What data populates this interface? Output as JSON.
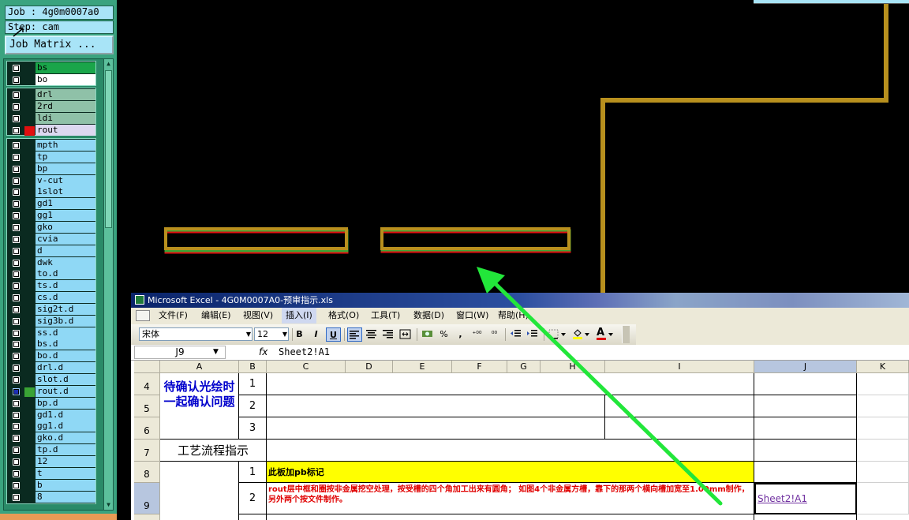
{
  "genesis": {
    "job_label": "Job : 4g0m0007a0",
    "step_label": "Step: cam",
    "job_matrix_button": "Job Matrix ...",
    "layers_group1": [
      {
        "name": "bs",
        "color": "#1aa54a",
        "checked": false,
        "swatch": ""
      },
      {
        "name": "bo",
        "color": "#ffffff",
        "checked": false,
        "swatch": ""
      }
    ],
    "layers_group2": [
      {
        "name": "drl",
        "color": "#8fc1a8",
        "checked": false,
        "swatch": ""
      },
      {
        "name": "2rd",
        "color": "#8fc1a8",
        "checked": false,
        "swatch": ""
      },
      {
        "name": "ldi",
        "color": "#8fc1a8",
        "checked": false,
        "swatch": ""
      },
      {
        "name": "rout",
        "color": "#dcd8f0",
        "checked": false,
        "swatch": "#e01010"
      }
    ],
    "layers_group3": [
      {
        "name": "mpth",
        "color": "#8fd8f5",
        "checked": false,
        "swatch": "",
        "mark": ""
      },
      {
        "name": "tp",
        "color": "#8fd8f5",
        "checked": false,
        "swatch": "",
        "mark": ""
      },
      {
        "name": "bp",
        "color": "#8fd8f5",
        "checked": false,
        "swatch": "",
        "mark": ""
      },
      {
        "name": "v-cut",
        "color": "#8fd8f5",
        "checked": false,
        "swatch": "",
        "mark": ""
      },
      {
        "name": "1slot",
        "color": "#8fd8f5",
        "checked": false,
        "swatch": "",
        "mark": ""
      },
      {
        "name": "gd1",
        "color": "#8fd8f5",
        "checked": false,
        "swatch": "",
        "mark": ""
      },
      {
        "name": "gg1",
        "color": "#8fd8f5",
        "checked": false,
        "swatch": "",
        "mark": ""
      },
      {
        "name": "gko",
        "color": "#8fd8f5",
        "checked": false,
        "swatch": "",
        "mark": ""
      },
      {
        "name": "cvia",
        "color": "#8fd8f5",
        "checked": false,
        "swatch": "",
        "mark": ""
      },
      {
        "name": "d",
        "color": "#8fd8f5",
        "checked": false,
        "swatch": "",
        "mark": ""
      },
      {
        "name": "dwk",
        "color": "#8fd8f5",
        "checked": false,
        "swatch": "",
        "mark": ""
      },
      {
        "name": "to.d",
        "color": "#8fd8f5",
        "checked": false,
        "swatch": "",
        "mark": ""
      },
      {
        "name": "ts.d",
        "color": "#8fd8f5",
        "checked": false,
        "swatch": "",
        "mark": ""
      },
      {
        "name": "cs.d",
        "color": "#8fd8f5",
        "checked": false,
        "swatch": "",
        "mark": ""
      },
      {
        "name": "sig2t.d",
        "color": "#8fd8f5",
        "checked": false,
        "swatch": "",
        "mark": "⬋"
      },
      {
        "name": "sig3b.d",
        "color": "#8fd8f5",
        "checked": false,
        "swatch": "",
        "mark": "⬋"
      },
      {
        "name": "ss.d",
        "color": "#8fd8f5",
        "checked": false,
        "swatch": "",
        "mark": ""
      },
      {
        "name": "bs.d",
        "color": "#8fd8f5",
        "checked": false,
        "swatch": "",
        "mark": ""
      },
      {
        "name": "bo.d",
        "color": "#8fd8f5",
        "checked": false,
        "swatch": "",
        "mark": ""
      },
      {
        "name": "drl.d",
        "color": "#8fd8f5",
        "checked": false,
        "swatch": "",
        "mark": ""
      },
      {
        "name": "slot.d",
        "color": "#8fd8f5",
        "checked": false,
        "swatch": "",
        "mark": ""
      },
      {
        "name": "rout.d",
        "color": "#8fd8f5",
        "checked": true,
        "swatch": "#3aa335",
        "mark": "▪"
      },
      {
        "name": "bp.d",
        "color": "#8fd8f5",
        "checked": false,
        "swatch": "",
        "mark": ""
      },
      {
        "name": "gd1.d",
        "color": "#8fd8f5",
        "checked": false,
        "swatch": "",
        "mark": ""
      },
      {
        "name": "gg1.d",
        "color": "#8fd8f5",
        "checked": false,
        "swatch": "",
        "mark": ""
      },
      {
        "name": "gko.d",
        "color": "#8fd8f5",
        "checked": false,
        "swatch": "",
        "mark": ""
      },
      {
        "name": "tp.d",
        "color": "#8fd8f5",
        "checked": false,
        "swatch": "",
        "mark": ""
      },
      {
        "name": "12",
        "color": "#8fd8f5",
        "checked": false,
        "swatch": "",
        "mark": ""
      },
      {
        "name": "t",
        "color": "#8fd8f5",
        "checked": false,
        "swatch": "",
        "mark": ""
      },
      {
        "name": "b",
        "color": "#8fd8f5",
        "checked": false,
        "swatch": "",
        "mark": ""
      },
      {
        "name": "8",
        "color": "#8fd8f5",
        "checked": false,
        "swatch": "",
        "mark": ""
      }
    ],
    "colors": {
      "trace": "#b8901e",
      "outline_red": "#e01010",
      "outline_green": "#3aa335",
      "arrow": "#22e63a"
    }
  },
  "excel": {
    "title": "Microsoft Excel - 4G0M0007A0-预审指示.xls",
    "menu": [
      "文件(F)",
      "编辑(E)",
      "视图(V)",
      "插入(I)",
      "格式(O)",
      "工具(T)",
      "数据(D)",
      "窗口(W)",
      "帮助(H)"
    ],
    "font_name": "宋体",
    "font_size": "12",
    "toolbar": {
      "bold": "B",
      "italic": "I",
      "underline": "U",
      "percent": "%",
      "comma": ",",
      "inc_decimal": "⁺⁰⁰",
      "dec_decimal": "⁰⁰",
      "font_color": "A"
    },
    "name_box": "J9",
    "fx": "fx",
    "formula": "Sheet2!A1",
    "columns": [
      "A",
      "B",
      "C",
      "D",
      "E",
      "F",
      "G",
      "H",
      "I",
      "J",
      "K"
    ],
    "rows": [
      "4",
      "5",
      "6",
      "7",
      "8",
      "9"
    ],
    "cells": {
      "a4_6": "待确认光绘时一起确认问题",
      "b4": "1",
      "b5": "2",
      "b6": "3",
      "a7": "工艺流程指示",
      "b8": "1",
      "c8": "此板加pb标记",
      "b9": "2",
      "c9": "rout层中框和圈按非金属挖空处理，按受槽的四个角加工出来有圆角； 如图4个非金属方槽，靠下的那两个横向槽加宽至1.00mm制作，另外两个按文件制作。",
      "j9": "Sheet2!A1"
    }
  }
}
